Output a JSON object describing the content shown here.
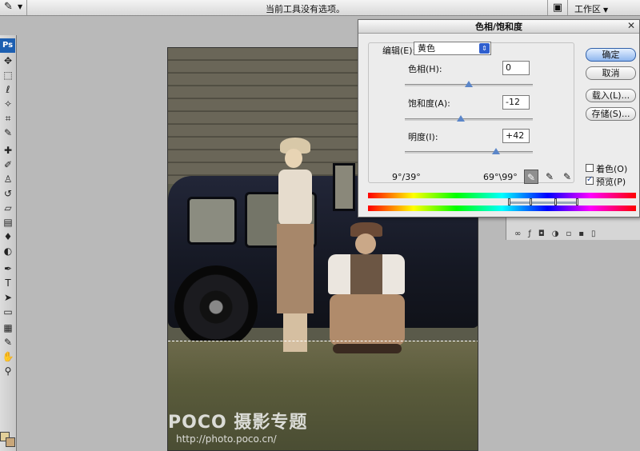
{
  "options_bar": {
    "tool_icon": "eyedropper-icon",
    "message": "当前工具没有选项。",
    "workspace_label": "工作区"
  },
  "toolbox": {
    "logo": "Ps",
    "tools": [
      "move-icon",
      "marquee-icon",
      "lasso-icon",
      "quick-selection-icon",
      "crop-icon",
      "eyedropper-icon",
      "healing-brush-icon",
      "brush-icon",
      "clone-stamp-icon",
      "history-brush-icon",
      "eraser-icon",
      "gradient-icon",
      "blur-icon",
      "dodge-icon",
      "pen-icon",
      "type-icon",
      "path-selection-icon",
      "shape-icon",
      "notes-icon",
      "eyedropper-icon",
      "hand-icon",
      "zoom-icon"
    ],
    "foreground_color": "#e2cf99",
    "background_color": "#c9a77a"
  },
  "watermark": {
    "brand": "POCO 摄影专题",
    "url": "http://photo.poco.cn/"
  },
  "dialog": {
    "title": "色相/饱和度",
    "edit_label": "编辑(E):",
    "edit_value": "黄色",
    "hue": {
      "label": "色相(H):",
      "value": "0",
      "min": -180,
      "max": 180
    },
    "saturation": {
      "label": "饱和度(A):",
      "value": "-12",
      "min": -100,
      "max": 100
    },
    "lightness": {
      "label": "明度(I):",
      "value": "+42",
      "min": -100,
      "max": 100
    },
    "buttons": {
      "ok": "确定",
      "cancel": "取消",
      "load": "载入(L)...",
      "save": "存储(S)..."
    },
    "colorize_label": "着色(O)",
    "colorize_checked": false,
    "preview_label": "预览(P)",
    "preview_checked": true,
    "range_left": "9°/39°",
    "range_right": "69°\\99°"
  }
}
